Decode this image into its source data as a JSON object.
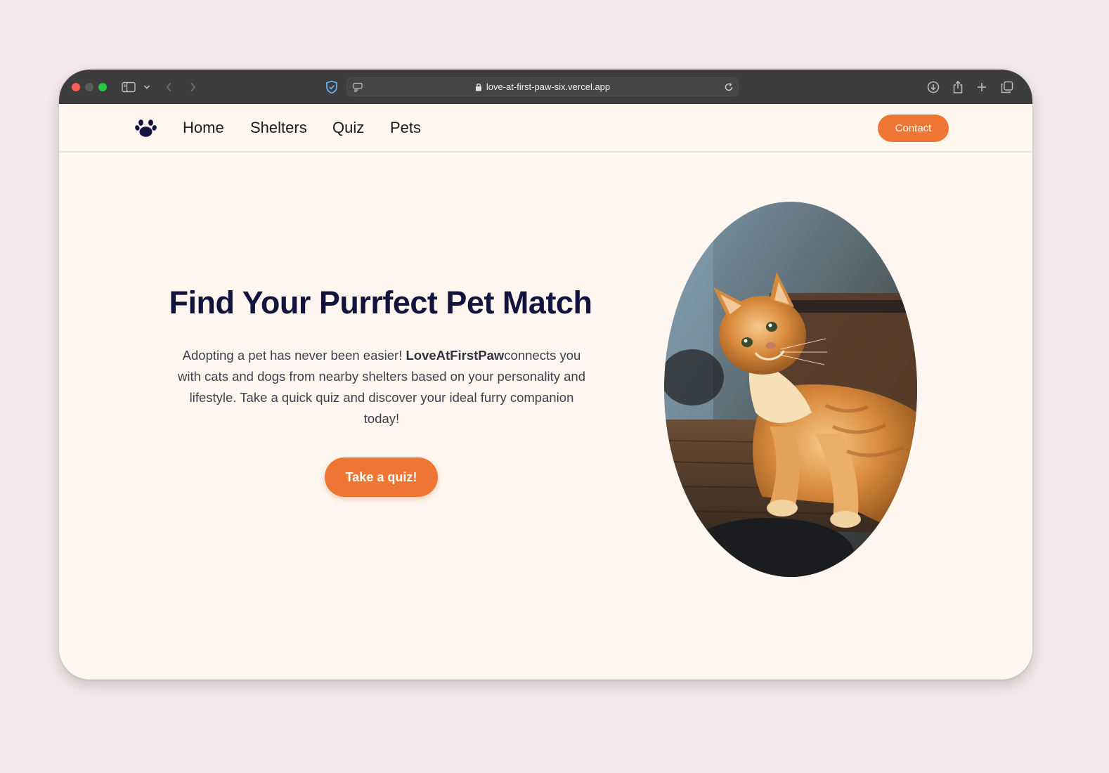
{
  "browser": {
    "url": "love-at-first-paw-six.vercel.app"
  },
  "nav": {
    "logo_icon": "paw-icon",
    "items": [
      {
        "label": "Home"
      },
      {
        "label": "Shelters"
      },
      {
        "label": "Quiz"
      },
      {
        "label": "Pets"
      }
    ],
    "contact_label": "Contact"
  },
  "hero": {
    "title": "Find Your Purrfect Pet Match",
    "text_before": "Adopting a pet has never been easier! ",
    "brand": "LoveAtFirstPaw",
    "text_after": "connects you with cats and dogs from nearby shelters based on your personality and lifestyle. Take a quick quiz and discover your ideal furry companion today!",
    "cta_label": "Take a quiz!",
    "image_icon": "orange-cat-photo"
  },
  "colors": {
    "accent": "#ef7632",
    "heading": "#12143d",
    "page_bg": "#fff7ef",
    "backdrop": "#f4eaeb"
  }
}
